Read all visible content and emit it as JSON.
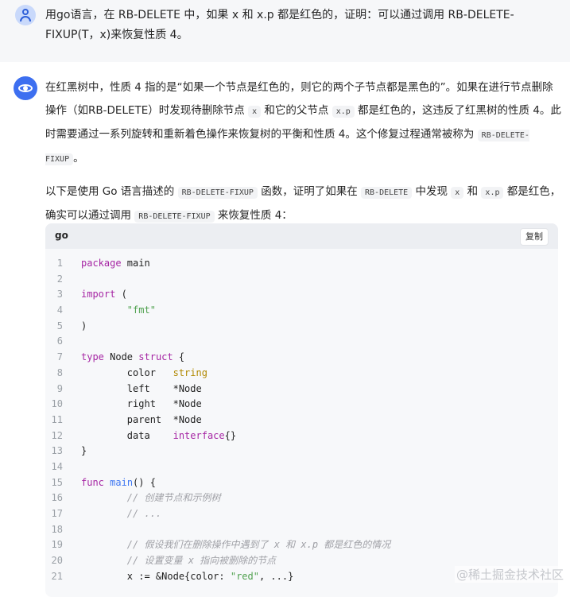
{
  "user_message": {
    "text": "用go语言，在 RB-DELETE 中，如果 x 和 x.p 都是红色的，证明：可以通过调用 RB-DELETE-FIXUP(T，x)来恢复性质 4。"
  },
  "assistant_message": {
    "para1": {
      "pre": "在红黑树中，性质 4 指的是“如果一个节点是红色的，则它的两个子节点都是黑色的”。如果在进行节点删除操作（如RB-DELETE）时发现待删除节点 ",
      "code1": "x",
      "mid1": " 和它的父节点 ",
      "code2": "x.p",
      "mid2": " 都是红色的，这违反了红黑树的性质 4。此时需要通过一系列旋转和重新着色操作来恢复树的平衡和性质 4。这个修复过程通常被称为 ",
      "code3": "RB-DELETE-FIXUP",
      "post": "。"
    },
    "para2": {
      "pre": "以下是使用 Go 语言描述的 ",
      "code1": "RB-DELETE-FIXUP",
      "mid1": " 函数，证明了如果在 ",
      "code2": "RB-DELETE",
      "mid2": " 中发现 ",
      "code3": "x",
      "mid3": " 和 ",
      "code4": "x.p",
      "mid4": " 都是红色，确实可以通过调用 ",
      "code5": "RB-DELETE-FIXUP",
      "post": " 来恢复性质 4："
    }
  },
  "code_block": {
    "language": "go",
    "copy_label": "复制",
    "lines": [
      {
        "n": "1",
        "parts": [
          {
            "t": "package",
            "c": "kw"
          },
          {
            "t": " main",
            "c": ""
          }
        ]
      },
      {
        "n": "2",
        "parts": []
      },
      {
        "n": "3",
        "parts": [
          {
            "t": "import",
            "c": "kw"
          },
          {
            "t": " (",
            "c": ""
          }
        ]
      },
      {
        "n": "4",
        "parts": [
          {
            "t": "        ",
            "c": ""
          },
          {
            "t": "\"fmt\"",
            "c": "str"
          }
        ]
      },
      {
        "n": "5",
        "parts": [
          {
            "t": ")",
            "c": ""
          }
        ]
      },
      {
        "n": "6",
        "parts": []
      },
      {
        "n": "7",
        "parts": [
          {
            "t": "type",
            "c": "kw"
          },
          {
            "t": " Node ",
            "c": ""
          },
          {
            "t": "struct",
            "c": "kw"
          },
          {
            "t": " {",
            "c": ""
          }
        ]
      },
      {
        "n": "8",
        "parts": [
          {
            "t": "        color   ",
            "c": ""
          },
          {
            "t": "string",
            "c": "typ"
          }
        ]
      },
      {
        "n": "9",
        "parts": [
          {
            "t": "        left    *Node",
            "c": ""
          }
        ]
      },
      {
        "n": "10",
        "parts": [
          {
            "t": "        right   *Node",
            "c": ""
          }
        ]
      },
      {
        "n": "11",
        "parts": [
          {
            "t": "        parent  *Node",
            "c": ""
          }
        ]
      },
      {
        "n": "12",
        "parts": [
          {
            "t": "        data    ",
            "c": ""
          },
          {
            "t": "interface",
            "c": "kw"
          },
          {
            "t": "{}",
            "c": ""
          }
        ]
      },
      {
        "n": "13",
        "parts": [
          {
            "t": "}",
            "c": ""
          }
        ]
      },
      {
        "n": "14",
        "parts": []
      },
      {
        "n": "15",
        "parts": [
          {
            "t": "func",
            "c": "kw"
          },
          {
            "t": " ",
            "c": ""
          },
          {
            "t": "main",
            "c": "fn"
          },
          {
            "t": "() {",
            "c": ""
          }
        ]
      },
      {
        "n": "16",
        "parts": [
          {
            "t": "        ",
            "c": ""
          },
          {
            "t": "// 创建节点和示例树",
            "c": "cmt"
          }
        ]
      },
      {
        "n": "17",
        "parts": [
          {
            "t": "        ",
            "c": ""
          },
          {
            "t": "// ...",
            "c": "cmt"
          }
        ]
      },
      {
        "n": "18",
        "parts": []
      },
      {
        "n": "19",
        "parts": [
          {
            "t": "        ",
            "c": ""
          },
          {
            "t": "// 假设我们在删除操作中遇到了 x 和 x.p 都是红色的情况",
            "c": "cmt"
          }
        ]
      },
      {
        "n": "20",
        "parts": [
          {
            "t": "        ",
            "c": ""
          },
          {
            "t": "// 设置变量 x 指向被删除的节点",
            "c": "cmt"
          }
        ]
      },
      {
        "n": "21",
        "parts": [
          {
            "t": "        x := &Node{color: ",
            "c": ""
          },
          {
            "t": "\"red\"",
            "c": "str"
          },
          {
            "t": ", ...}",
            "c": ""
          }
        ]
      }
    ]
  },
  "watermark": "@稀土掘金技术社区"
}
